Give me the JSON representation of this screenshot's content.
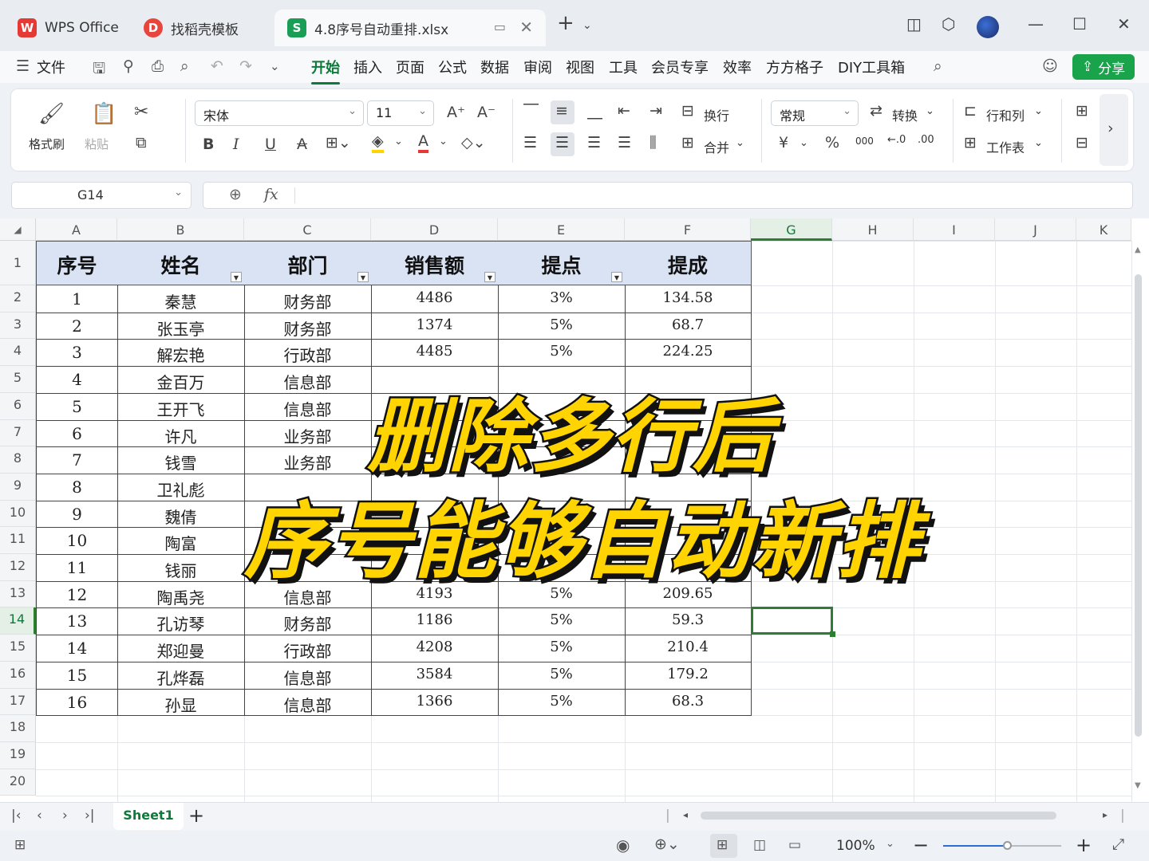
{
  "tabs": [
    {
      "label": "WPS Office",
      "logo": "W"
    },
    {
      "label": "找稻壳模板",
      "logo": "D"
    },
    {
      "label": "4.8序号自动重排.xlsx",
      "logo": "S"
    }
  ],
  "menu": {
    "file": "文件",
    "items": [
      "开始",
      "插入",
      "页面",
      "公式",
      "数据",
      "审阅",
      "视图",
      "工具",
      "会员专享",
      "效率",
      "方方格子",
      "DIY工具箱"
    ],
    "active": "开始",
    "share": "分享"
  },
  "ribbon": {
    "format_painter": "格式刷",
    "paste": "粘贴",
    "font_name": "宋体",
    "font_size": "11",
    "wrap": "换行",
    "merge": "合并",
    "number_format": "常规",
    "convert": "转换",
    "rowcol": "行和列",
    "worksheet": "工作表",
    "bold": "B",
    "italic": "I",
    "underline": "U",
    "strike": "A",
    "grow_font": "A⁺",
    "shrink_font": "A⁻",
    "currency": "¥",
    "percent": "%",
    "thousands": "000"
  },
  "formula": {
    "name_box": "G14",
    "fx": "fx",
    "value": ""
  },
  "columns": [
    "A",
    "B",
    "C",
    "D",
    "E",
    "F",
    "G",
    "H",
    "I",
    "J",
    "K"
  ],
  "active_column": "G",
  "active_row": "14",
  "row_numbers": [
    "1",
    "2",
    "3",
    "4",
    "5",
    "6",
    "7",
    "8",
    "9",
    "10",
    "11",
    "12",
    "13",
    "14",
    "15",
    "16",
    "17",
    "18",
    "19",
    "20"
  ],
  "table_headers": [
    "序号",
    "姓名",
    "部门",
    "销售额",
    "提点",
    "提成"
  ],
  "table_rows": [
    [
      "1",
      "秦慧",
      "财务部",
      "4486",
      "3%",
      "134.58"
    ],
    [
      "2",
      "张玉亭",
      "财务部",
      "1374",
      "5%",
      "68.7"
    ],
    [
      "3",
      "解宏艳",
      "行政部",
      "4485",
      "5%",
      "224.25"
    ],
    [
      "4",
      "金百万",
      "信息部",
      "",
      "",
      ""
    ],
    [
      "5",
      "王开飞",
      "信息部",
      "",
      "",
      ""
    ],
    [
      "6",
      "许凡",
      "业务部",
      "",
      "",
      ""
    ],
    [
      "7",
      "钱雪",
      "业务部",
      "",
      "",
      ""
    ],
    [
      "8",
      "卫礼彪",
      "",
      "",
      "",
      ""
    ],
    [
      "9",
      "魏倩",
      "",
      "",
      "",
      ""
    ],
    [
      "10",
      "陶富",
      "",
      "",
      "",
      ""
    ],
    [
      "11",
      "钱丽",
      "",
      "",
      "5%",
      ""
    ],
    [
      "12",
      "陶禹尧",
      "信息部",
      "4193",
      "5%",
      "209.65"
    ],
    [
      "13",
      "孔访琴",
      "财务部",
      "1186",
      "5%",
      "59.3"
    ],
    [
      "14",
      "郑迎曼",
      "行政部",
      "4208",
      "5%",
      "210.4"
    ],
    [
      "15",
      "孔烨磊",
      "信息部",
      "3584",
      "5%",
      "179.2"
    ],
    [
      "16",
      "孙显",
      "信息部",
      "1366",
      "5%",
      "68.3"
    ]
  ],
  "overlay": {
    "line1": "删除多行后",
    "line2": "序号能够自动新排"
  },
  "sheets": [
    "Sheet1"
  ],
  "status": {
    "zoom": "100%",
    "zoom_level": 0.55
  },
  "colors": {
    "accent": "#0d7a3a",
    "header_fill": "#dae3f3",
    "overlay_text": "#ffd400",
    "share": "#19a34a"
  }
}
